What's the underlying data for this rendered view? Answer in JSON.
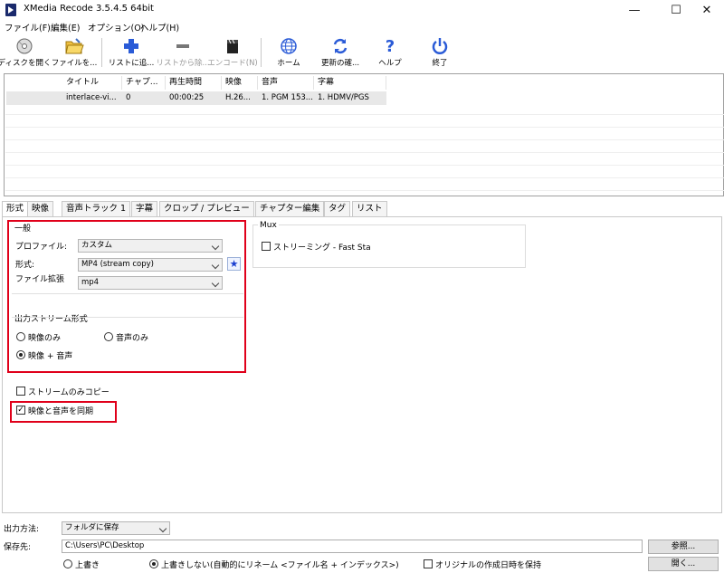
{
  "window": {
    "title": "XMedia Recode 3.5.4.5 64bit",
    "minimize": "—",
    "maximize": "☐",
    "close": "✕"
  },
  "menu": [
    "ファイル(F)",
    "編集(E)",
    "オプション(O)",
    "ヘルプ(H)"
  ],
  "toolbar": {
    "open_disc": "ディスクを開く",
    "open_file": "ファイルを...",
    "add_list": "リストに追...",
    "remove_list": "リストから除...",
    "encode": "エンコード(N)",
    "home": "ホーム",
    "update": "更新の確...",
    "help": "ヘルプ",
    "exit": "終了"
  },
  "filelist": {
    "headers": [
      "タイトル",
      "チャプ...",
      "再生時間",
      "映像",
      "音声",
      "字幕"
    ],
    "rows": [
      [
        "interlace-vi...",
        "0",
        "00:00:25",
        "H.26...",
        "1. PGM 153...",
        "1. HDMV/PGS"
      ]
    ]
  },
  "tabs": [
    "形式",
    "映像",
    "音声トラック 1",
    "字幕",
    "クロップ / プレビュー",
    "チャプター編集",
    "タグ",
    "リスト"
  ],
  "format": {
    "group_general": "一般",
    "profile_label": "プロファイル:",
    "profile_value": "カスタム",
    "format_label": "形式:",
    "format_value": "MP4 (stream copy)",
    "ext_label": "ファイル拡張子:",
    "ext_value": "mp4",
    "output_stream_label": "出力ストリーム形式",
    "video_only": "映像のみ",
    "audio_only": "音声のみ",
    "video_audio": "映像 + 音声",
    "stream_copy_only": "ストリームのみコピー",
    "sync_av": "映像と音声を同期",
    "mux_label": "Mux",
    "streaming": "ストリーミング - Fast Sta"
  },
  "bottom": {
    "output_method_label": "出力方法:",
    "output_method_value": "フォルダに保存",
    "save_to_label": "保存先:",
    "save_path": "C:\\Users\\PC\\Desktop",
    "browse": "参照...",
    "open": "開く...",
    "overwrite": "上書き",
    "no_overwrite": "上書きしない(自動的にリネーム <ファイル名 + インデックス>)",
    "keep_date": "オリジナルの作成日時を保持"
  }
}
